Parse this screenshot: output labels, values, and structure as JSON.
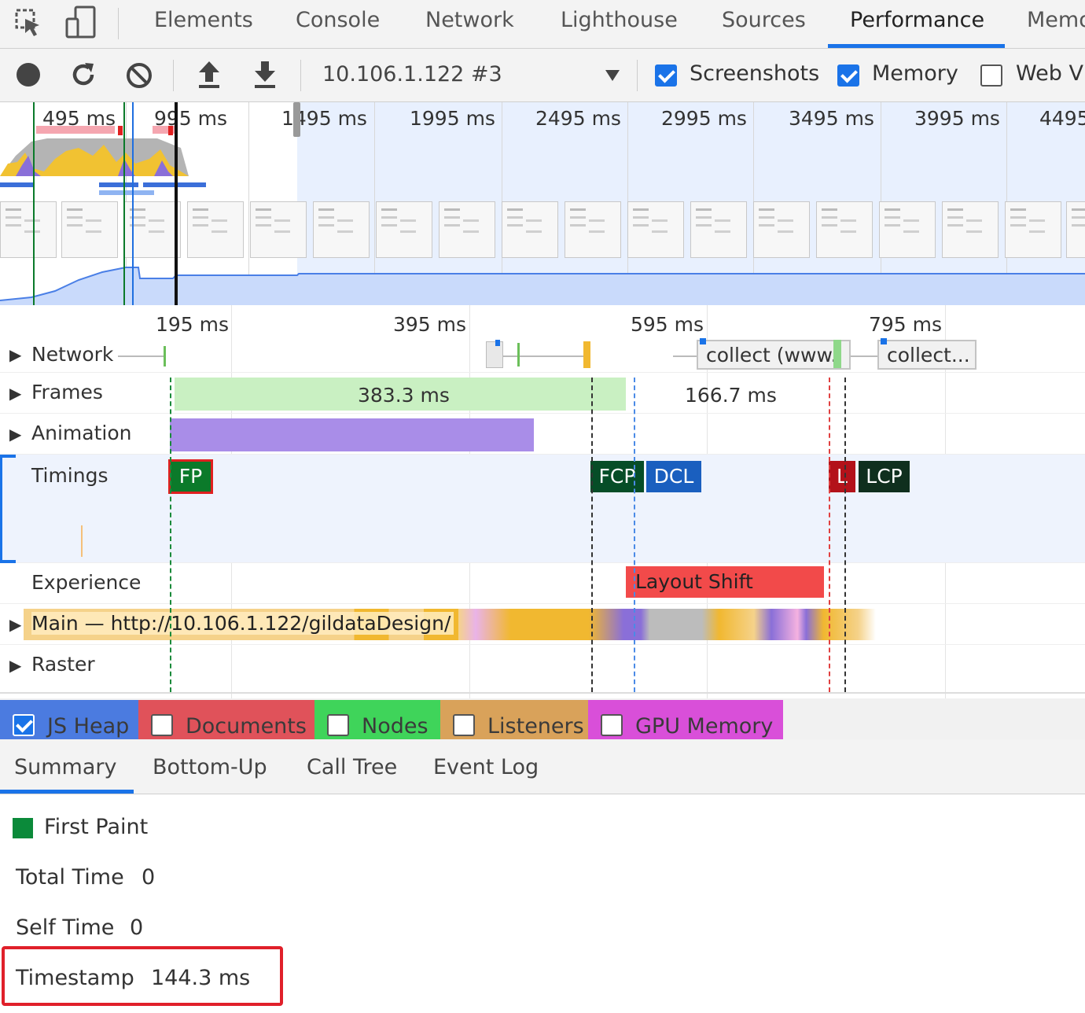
{
  "tabs": [
    "Elements",
    "Console",
    "Network",
    "Lighthouse",
    "Sources",
    "Performance",
    "Memo"
  ],
  "toolbar": {
    "profile_select": "10.106.1.122 #3",
    "checkboxes": [
      {
        "label": "Screenshots",
        "checked": true
      },
      {
        "label": "Memory",
        "checked": true
      },
      {
        "label": "Web V",
        "checked": false
      }
    ]
  },
  "overview": {
    "ticks": [
      "495 ms",
      "995 ms",
      "1495 ms",
      "1995 ms",
      "2495 ms",
      "2995 ms",
      "3495 ms",
      "3995 ms",
      "4495"
    ]
  },
  "flamechart": {
    "ticks": [
      "195 ms",
      "395 ms",
      "595 ms",
      "795 ms"
    ],
    "tracks": {
      "network": "Network",
      "frames": "Frames",
      "animation": "Animation",
      "timings": "Timings",
      "experience": "Experience",
      "main": "Main — http://10.106.1.122/gildataDesign/",
      "raster": "Raster"
    },
    "network_items": [
      "collect (www.g...",
      "collect..."
    ],
    "frame_labels": [
      "383.3 ms",
      "166.7 ms"
    ],
    "timing_markers": [
      "FP",
      "FCP",
      "DCL",
      "L",
      "LCP"
    ],
    "experience_item": "Layout Shift"
  },
  "memory_counters": [
    {
      "label": "JS Heap",
      "checked": true,
      "color": "#4b7be0"
    },
    {
      "label": "Documents",
      "checked": false,
      "color": "#e0525a"
    },
    {
      "label": "Nodes",
      "checked": false,
      "color": "#3fd45a"
    },
    {
      "label": "Listeners",
      "checked": false,
      "color": "#d9a25a"
    },
    {
      "label": "GPU Memory",
      "checked": false,
      "color": "#d94fd9"
    }
  ],
  "bottom_tabs": [
    "Summary",
    "Bottom-Up",
    "Call Tree",
    "Event Log"
  ],
  "summary": {
    "event_title": "First Paint",
    "event_color": "#0b8a3a",
    "rows": [
      {
        "label": "Total Time",
        "value": "0"
      },
      {
        "label": "Self Time",
        "value": "0"
      },
      {
        "label": "Timestamp",
        "value": "144.3 ms"
      }
    ]
  }
}
